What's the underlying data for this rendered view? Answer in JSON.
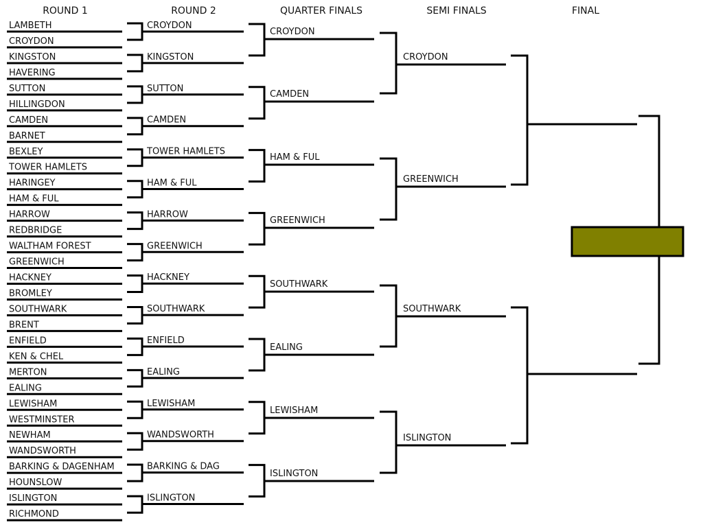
{
  "headers": [
    "ROUND 1",
    "ROUND 2",
    "QUARTER FINALS",
    "SEMI FINALS",
    "FINAL"
  ],
  "round1": [
    "LAMBETH",
    "CROYDON",
    "KINGSTON",
    "HAVERING",
    "SUTTON",
    "HILLINGDON",
    "CAMDEN",
    "BARNET",
    "BEXLEY",
    "TOWER HAMLETS",
    "HARINGEY",
    "HAM & FUL",
    "HARROW",
    "REDBRIDGE",
    "WALTHAM FOREST",
    "GREENWICH",
    "HACKNEY",
    "BROMLEY",
    "SOUTHWARK",
    "BRENT",
    "ENFIELD",
    "KEN & CHEL",
    "MERTON",
    "EALING",
    "LEWISHAM",
    "WESTMINSTER",
    "NEWHAM",
    "WANDSWORTH",
    "BARKING & DAGENHAM",
    "HOUNSLOW",
    "ISLINGTON",
    "RICHMOND"
  ],
  "round2": [
    "CROYDON",
    "KINGSTON",
    "SUTTON",
    "CAMDEN",
    "TOWER HAMLETS",
    "HAM & FUL",
    "HARROW",
    "GREENWICH",
    "HACKNEY",
    "SOUTHWARK",
    "ENFIELD",
    "EALING",
    "LEWISHAM",
    "WANDSWORTH",
    "BARKING & DAG",
    "ISLINGTON"
  ],
  "quarter_finals": [
    "CROYDON",
    "CAMDEN",
    "HAM & FUL",
    "GREENWICH",
    "SOUTHWARK",
    "EALING",
    "LEWISHAM",
    "ISLINGTON"
  ],
  "semi_finals": [
    "CROYDON",
    "GREENWICH",
    "SOUTHWARK",
    "ISLINGTON"
  ],
  "final": [
    "",
    ""
  ],
  "colors": {
    "winner_box": "#808000",
    "lines": "#000000"
  }
}
